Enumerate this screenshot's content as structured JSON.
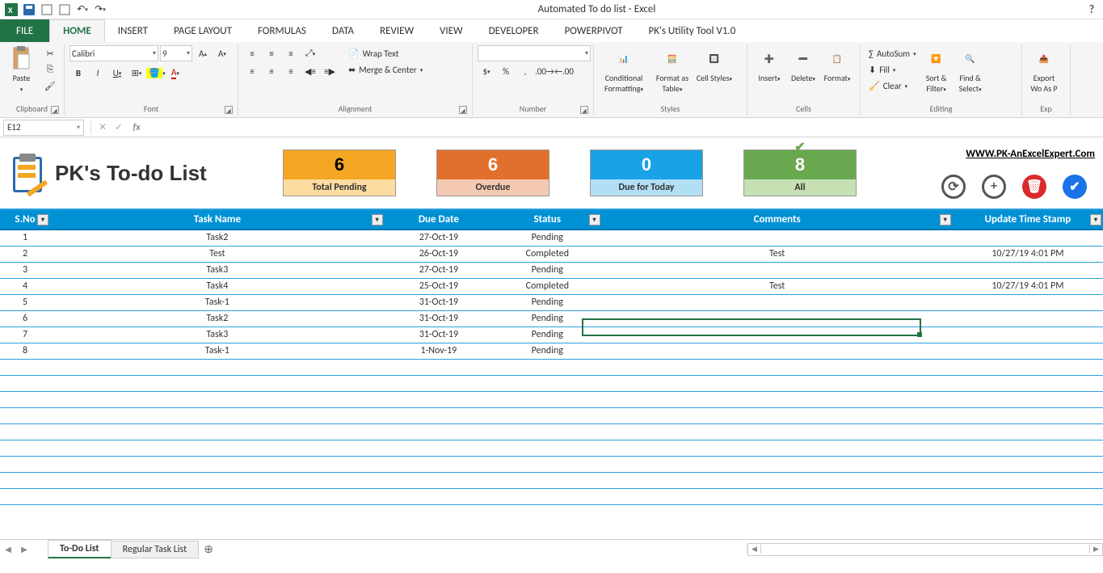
{
  "app_title": "Automated To do list - Excel",
  "tabs": {
    "file": "FILE",
    "list": [
      "HOME",
      "INSERT",
      "PAGE LAYOUT",
      "FORMULAS",
      "DATA",
      "REVIEW",
      "VIEW",
      "DEVELOPER",
      "POWERPIVOT",
      "PK's Utility Tool V1.0"
    ],
    "active": "HOME"
  },
  "ribbon": {
    "clipboard": {
      "paste": "Paste",
      "label": "Clipboard"
    },
    "font": {
      "name": "Calibri",
      "size": "9",
      "label": "Font"
    },
    "alignment": {
      "wrap": "Wrap Text",
      "merge": "Merge & Center",
      "label": "Alignment"
    },
    "number": {
      "label": "Number"
    },
    "styles": {
      "cond": "Conditional Formatting",
      "fmtTable": "Format as Table",
      "cell": "Cell Styles",
      "label": "Styles"
    },
    "cells": {
      "insert": "Insert",
      "delete": "Delete",
      "format": "Format",
      "label": "Cells"
    },
    "editing": {
      "autosum": "AutoSum",
      "fill": "Fill",
      "clear": "Clear",
      "sort": "Sort & Filter",
      "find": "Find & Select",
      "label": "Editing"
    },
    "export": {
      "btn": "Export Wo As P",
      "label": "Exp"
    }
  },
  "formula_bar": {
    "cell_ref": "E12",
    "formula": ""
  },
  "dashboard": {
    "title": "PK's To-do List",
    "url": "WWW.PK-AnExcelExpert.Com",
    "kpis": [
      {
        "value": "6",
        "label": "Total Pending",
        "cls": "pending"
      },
      {
        "value": "6",
        "label": "Overdue",
        "cls": "overdue"
      },
      {
        "value": "0",
        "label": "Due for Today",
        "cls": "today"
      },
      {
        "value": "8",
        "label": "All",
        "cls": "all",
        "tick": true
      }
    ]
  },
  "table": {
    "headers": [
      "S.No",
      "Task Name",
      "Due Date",
      "Status",
      "Comments",
      "Update Time Stamp"
    ],
    "rows": [
      {
        "sno": "1",
        "task": "Task2",
        "due": "27-Oct-19",
        "status": "Pending",
        "comments": "",
        "ts": ""
      },
      {
        "sno": "2",
        "task": "Test",
        "due": "26-Oct-19",
        "status": "Completed",
        "comments": "Test",
        "ts": "10/27/19 4:01 PM"
      },
      {
        "sno": "3",
        "task": "Task3",
        "due": "27-Oct-19",
        "status": "Pending",
        "comments": "",
        "ts": ""
      },
      {
        "sno": "4",
        "task": "Task4",
        "due": "25-Oct-19",
        "status": "Completed",
        "comments": "Test",
        "ts": "10/27/19 4:01 PM"
      },
      {
        "sno": "5",
        "task": "Task-1",
        "due": "31-Oct-19",
        "status": "Pending",
        "comments": "",
        "ts": ""
      },
      {
        "sno": "6",
        "task": "Task2",
        "due": "31-Oct-19",
        "status": "Pending",
        "comments": "",
        "ts": ""
      },
      {
        "sno": "7",
        "task": "Task3",
        "due": "31-Oct-19",
        "status": "Pending",
        "comments": "",
        "ts": ""
      },
      {
        "sno": "8",
        "task": "Task-1",
        "due": "1-Nov-19",
        "status": "Pending",
        "comments": "",
        "ts": ""
      }
    ]
  },
  "sheets": {
    "active": "To-Do List",
    "others": [
      "Regular Task List"
    ]
  }
}
